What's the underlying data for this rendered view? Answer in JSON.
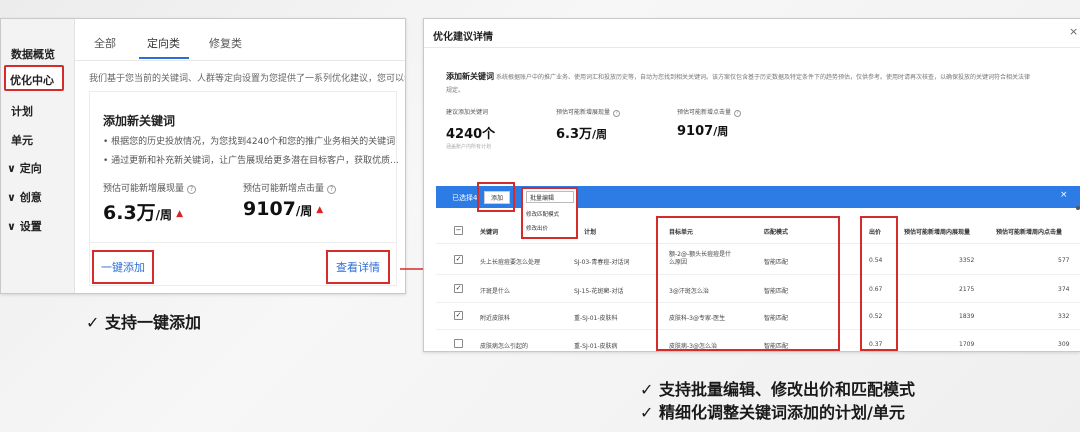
{
  "left": {
    "sidebar": {
      "items": [
        "数据概览",
        "优化中心",
        "计划",
        "单元",
        "定向",
        "创意",
        "设置"
      ],
      "active": "优化中心"
    },
    "tabs": [
      "全部",
      "定向类",
      "修复类"
    ],
    "active_tab": "定向类",
    "description": "我们基于您当前的关键词、人群等定向设置为您提供了一系列优化建议，您可以参考",
    "card": {
      "title": "添加新关键词",
      "bullets": [
        "• 根据您的历史投放情况，为您找到4240个和您的推广业务相关的关键词",
        "• 通过更新和补充新关键词，让广告展现给更多潜在目标客户，获取优质..."
      ],
      "metrics": [
        {
          "label": "预估可能新增展现量",
          "value": "6.3万",
          "unit": "/周"
        },
        {
          "label": "预估可能新增点击量",
          "value": "9107",
          "unit": "/周"
        }
      ],
      "one_click_label": "一键添加",
      "details_label": "查看详情"
    }
  },
  "captions": {
    "left": "✓ 支持一键添加",
    "right_1": "✓ 支持批量编辑、修改出价和匹配模式",
    "right_2": "✓ 精细化调整关键词添加的计划/单元"
  },
  "right": {
    "title": "优化建议详情",
    "close": "×",
    "rec_title": "添加新关键词",
    "rec_desc": "系统根据账户中的推广业务、使用词汇和投放历史等，自动为您找到相关关键词。该方案仅包含基于历史数据及特定条件下的趋势预估，仅供参考。使用时请再次核查，以确保投放的关键词符合相关法律",
    "rec_desc2": "规定。",
    "metrics": [
      {
        "label": "建议添加关键词",
        "value": "4240个",
        "unit": ""
      },
      {
        "label": "预估可能新增展现量",
        "value": "6.3万",
        "unit": "/周"
      },
      {
        "label": "预估可能新增点击量",
        "value": "9107",
        "unit": "/周"
      }
    ],
    "hint": "涵盖账户内所有计划",
    "toolbar": {
      "selected": "已选择4",
      "add": "添加",
      "batch_edit": "批量编辑",
      "dropdown": [
        "修改匹配模式",
        "修改出价"
      ],
      "close": "×"
    },
    "table": {
      "headers": [
        "关键词",
        "计划",
        "目标单元",
        "匹配模式",
        "出价",
        "预估可能新增周内展现量",
        "预估可能新增周内点击量"
      ],
      "rows": [
        {
          "checked": true,
          "keyword": "头上长痘痘要怎么处理",
          "plan": "SJ-03-青春痘-对话词",
          "unit": "额-2@-额头长痘痘是什么原因",
          "match": "智能匹配",
          "bid": "0.54",
          "impr": "3352",
          "clicks": "577"
        },
        {
          "checked": true,
          "keyword": "汗斑是什么",
          "plan": "SJ-15-花斑癣-对话",
          "unit": "3@汗斑怎么治",
          "match": "智能匹配",
          "bid": "0.67",
          "impr": "2175",
          "clicks": "374"
        },
        {
          "checked": true,
          "keyword": "附近皮肤科",
          "plan": "重-SJ-01-皮肤科",
          "unit": "皮肤科-3@专家-医生",
          "match": "智能匹配",
          "bid": "0.52",
          "impr": "1839",
          "clicks": "332"
        },
        {
          "checked": false,
          "keyword": "皮肤病怎么引起的",
          "plan": "重-SJ-01-皮肤病",
          "unit": "皮肤病-3@怎么治",
          "match": "智能匹配",
          "bid": "0.37",
          "impr": "1709",
          "clicks": "309"
        }
      ]
    }
  }
}
